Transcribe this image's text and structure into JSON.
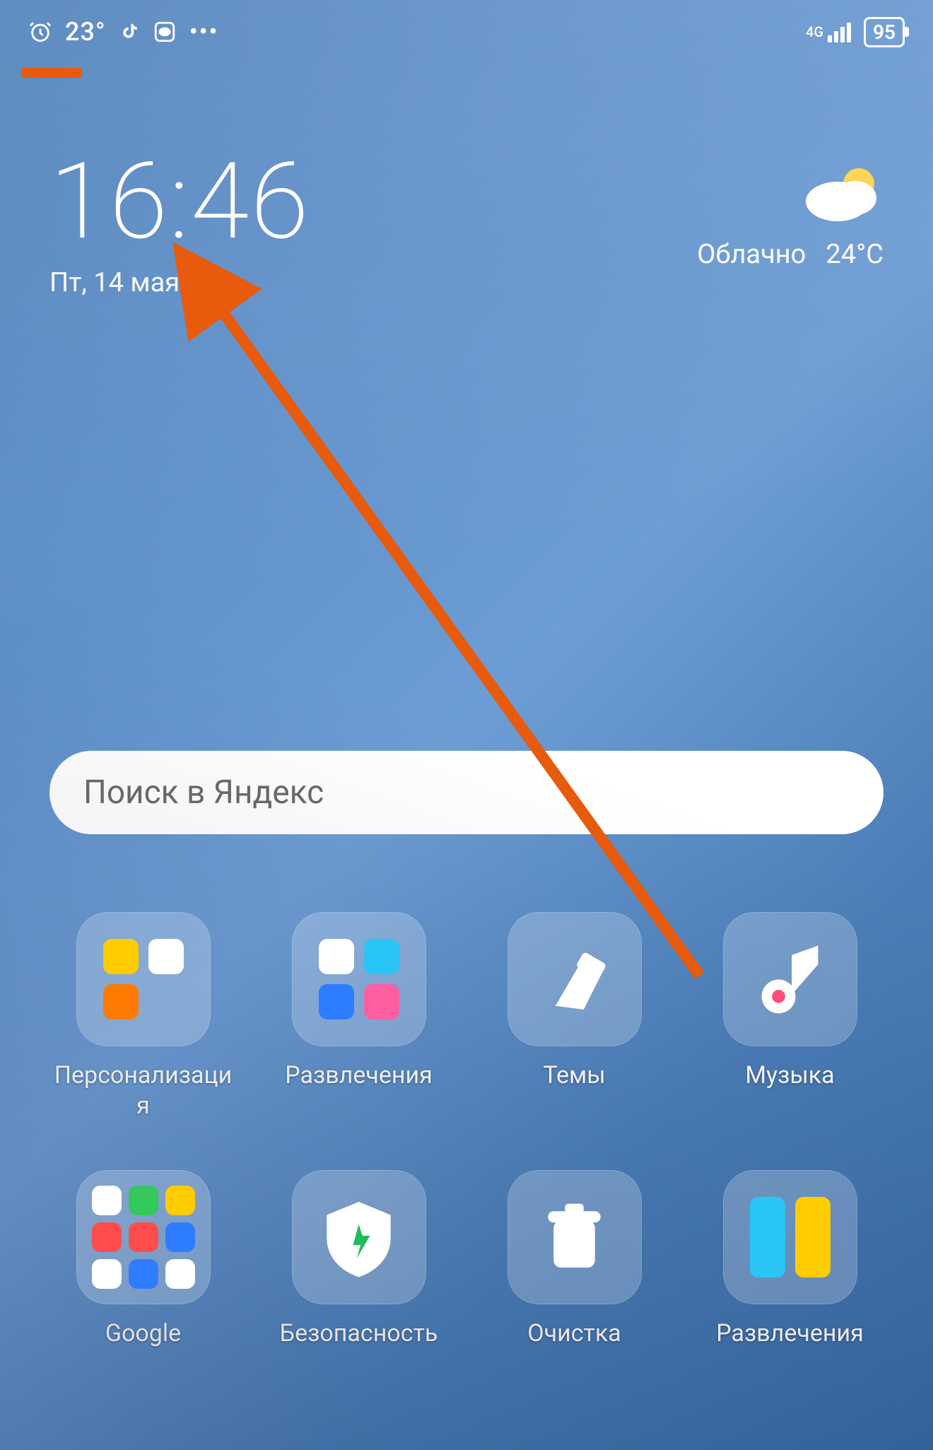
{
  "status": {
    "temperature": "23°",
    "network": "4G",
    "battery": "95",
    "icons": [
      "alarm",
      "tiktok",
      "chat",
      "more"
    ]
  },
  "clock": {
    "time": "16:46",
    "date": "Пт, 14 мая"
  },
  "weather": {
    "condition": "Облачно",
    "temp": "24°C"
  },
  "search": {
    "placeholder": "Поиск в Яндекс"
  },
  "apps": [
    {
      "key": "personalization",
      "label": "Персонализация",
      "type": "folder"
    },
    {
      "key": "entertainment1",
      "label": "Развлечения",
      "type": "folder"
    },
    {
      "key": "themes",
      "label": "Темы",
      "type": "app"
    },
    {
      "key": "music",
      "label": "Музыка",
      "type": "app"
    },
    {
      "key": "google",
      "label": "Google",
      "type": "folder"
    },
    {
      "key": "security",
      "label": "Безопасность",
      "type": "app"
    },
    {
      "key": "cleanup",
      "label": "Очистка",
      "type": "app"
    },
    {
      "key": "entertainment2",
      "label": "Развлечения",
      "type": "folder"
    }
  ],
  "annotation": {
    "arrow_color": "#e85a0c"
  }
}
